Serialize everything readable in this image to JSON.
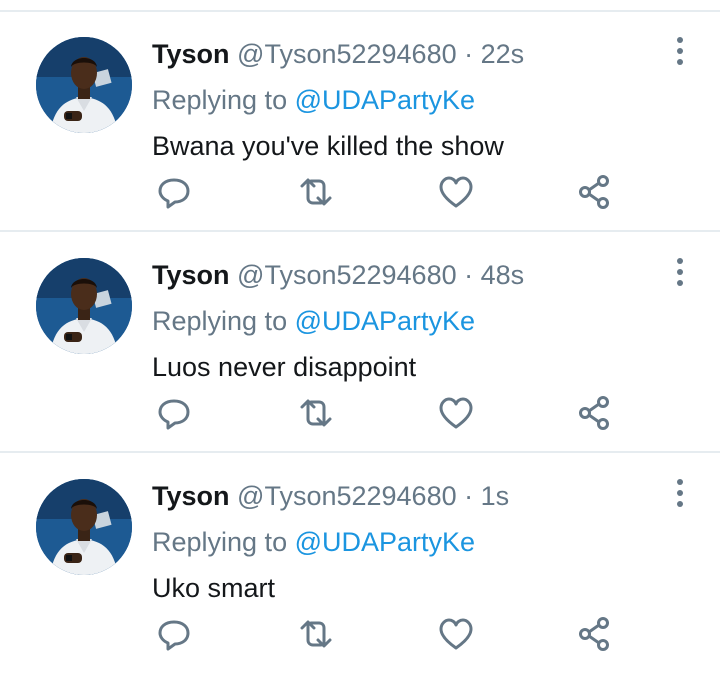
{
  "tweets": [
    {
      "name": "Tyson",
      "handle": "@Tyson52294680",
      "separator": "·",
      "time": "22s",
      "replying_prefix": "Replying to",
      "replying_to": "@UDAPartyKe",
      "text": "Bwana you've killed the show"
    },
    {
      "name": "Tyson",
      "handle": "@Tyson52294680",
      "separator": "·",
      "time": "48s",
      "replying_prefix": "Replying to",
      "replying_to": "@UDAPartyKe",
      "text": "Luos never disappoint"
    },
    {
      "name": "Tyson",
      "handle": "@Tyson52294680",
      "separator": "·",
      "time": "1s",
      "replying_prefix": "Replying to",
      "replying_to": "@UDAPartyKe",
      "text": "Uko smart"
    }
  ],
  "icons": {
    "reply": "reply-icon",
    "retweet": "retweet-icon",
    "like": "heart-icon",
    "share": "share-icon",
    "more": "more-options-icon"
  },
  "colors": {
    "name": "#14171a",
    "secondary": "#657786",
    "mention": "#1b95e0",
    "divider": "#e6ecf0",
    "icon": "#657786"
  }
}
